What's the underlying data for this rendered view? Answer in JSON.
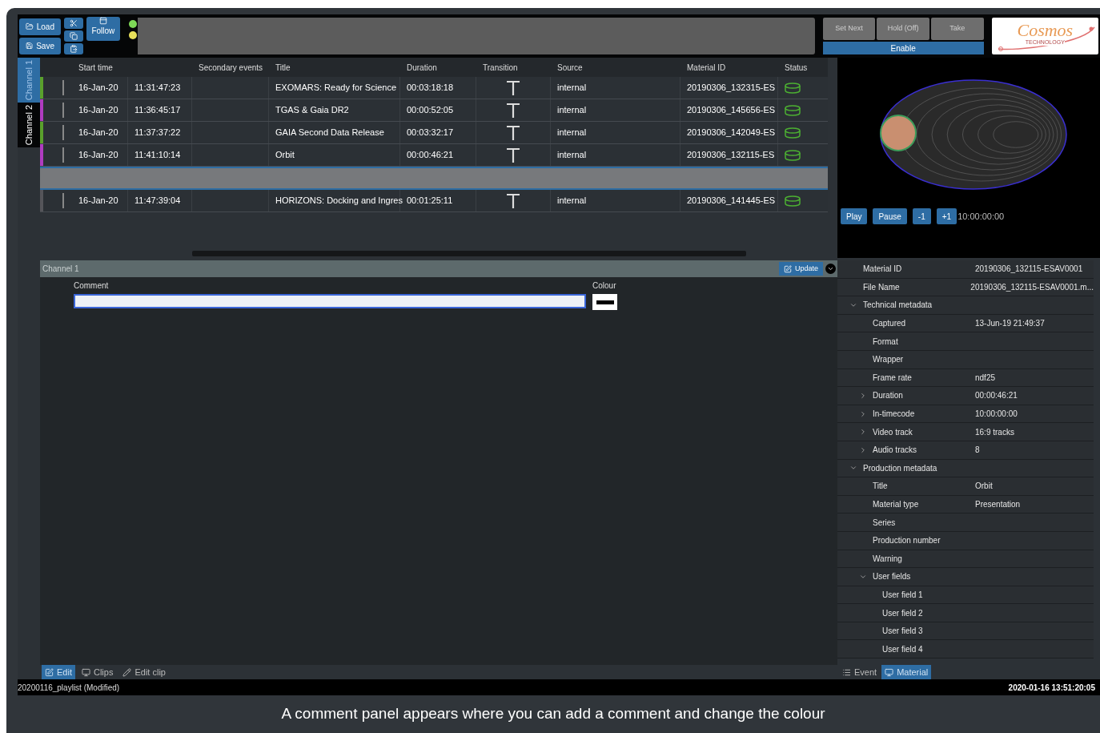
{
  "toolbar": {
    "load": "Load",
    "save": "Save",
    "follow": "Follow",
    "indicators": [
      {
        "color": "#7ed957"
      },
      {
        "color": "#e8e05a"
      }
    ],
    "take_buttons": [
      {
        "label": "Set Next",
        "disabled": true
      },
      {
        "label": "Hold (Off)",
        "disabled": true
      },
      {
        "label": "Take",
        "disabled": true
      }
    ],
    "enable": "Enable",
    "logo": {
      "name": "Cosmos",
      "tagline": "TECHNOLOGY"
    }
  },
  "channel_tabs": [
    {
      "label": "Channel 1",
      "selected": true
    },
    {
      "label": "Channel 2",
      "selected": false
    }
  ],
  "table": {
    "columns": [
      "Start time",
      "Secondary events",
      "Title",
      "Duration",
      "Transition",
      "Source",
      "Material ID",
      "Status"
    ],
    "rows": [
      {
        "kind": "event",
        "color": "#5aa02c",
        "selected": false,
        "date": "16-Jan-20",
        "time": "11:31:47:23",
        "title": "EXOMARS: Ready for Science",
        "duration": "00:03:18:18",
        "source": "internal",
        "material_id": "20190306_132315-ES"
      },
      {
        "kind": "event",
        "color": "#b03cc0",
        "selected": false,
        "date": "16-Jan-20",
        "time": "11:36:45:17",
        "title": "TGAS & Gaia DR2",
        "duration": "00:00:52:05",
        "source": "internal",
        "material_id": "20190306_145656-ES"
      },
      {
        "kind": "event",
        "color": "#5aa02c",
        "selected": false,
        "date": "16-Jan-20",
        "time": "11:37:37:22",
        "title": "GAIA Second Data Release",
        "duration": "00:03:32:17",
        "source": "internal",
        "material_id": "20190306_142049-ES"
      },
      {
        "kind": "event",
        "color": "#b03cc0",
        "selected": false,
        "date": "16-Jan-20",
        "time": "11:41:10:14",
        "title": "Orbit",
        "duration": "00:00:46:21",
        "source": "internal",
        "material_id": "20190306_132115-ES"
      },
      {
        "kind": "gap",
        "selected": true
      },
      {
        "kind": "event",
        "color": "#55555a",
        "selected": false,
        "date": "16-Jan-20",
        "time": "11:47:39:04",
        "title": "HORIZONS: Docking and Ingres",
        "duration": "00:01:25:11",
        "source": "internal",
        "material_id": "20190306_141445-ES"
      }
    ]
  },
  "preview": {
    "buttons": [
      "Play",
      "Pause",
      "-1",
      "+1"
    ],
    "timecode": "10:00:00:00"
  },
  "comment_panel": {
    "title": "Channel 1",
    "update": "Update",
    "comment_label": "Comment",
    "colour_label": "Colour"
  },
  "metadata": [
    {
      "label": "Material ID",
      "value": "20190306_132115-ESAV0001"
    },
    {
      "label": "File Name",
      "value": "20190306_132115-ESAV0001.m..."
    },
    {
      "label": "Technical metadata",
      "expanded": true,
      "children": [
        {
          "label": "Captured",
          "value": "13-Jun-19 21:49:37"
        },
        {
          "label": "Format"
        },
        {
          "label": "Wrapper"
        },
        {
          "label": "Frame rate",
          "value": "ndf25"
        },
        {
          "label": "Duration",
          "value": "00:00:46:21",
          "expanded": false
        },
        {
          "label": "In-timecode",
          "value": "10:00:00:00",
          "expanded": false
        },
        {
          "label": "Video track",
          "value": "16:9 tracks",
          "expanded": false
        },
        {
          "label": "Audio tracks",
          "value": "8",
          "expanded": false
        }
      ]
    },
    {
      "label": "Production metadata",
      "expanded": true,
      "children": [
        {
          "label": "Title",
          "value": "Orbit"
        },
        {
          "label": "Material type",
          "value": "Presentation"
        },
        {
          "label": "Series"
        },
        {
          "label": "Production number"
        },
        {
          "label": "Warning"
        },
        {
          "label": "User fields",
          "expanded": true,
          "children": [
            {
              "label": "User field 1"
            },
            {
              "label": "User field 2"
            },
            {
              "label": "User field 3"
            },
            {
              "label": "User field 4"
            }
          ]
        }
      ]
    }
  ],
  "left_tabs": [
    {
      "label": "Edit",
      "selected": true
    },
    {
      "label": "Clips",
      "selected": false
    },
    {
      "label": "Edit clip",
      "selected": false
    }
  ],
  "right_tabs": [
    {
      "label": "Event",
      "selected": false
    },
    {
      "label": "Material",
      "selected": true
    }
  ],
  "status_bar": {
    "file": "20200116_playlist (Modified)",
    "datetime": "2020-01-16 13:51:20:05"
  },
  "caption": "A comment panel appears where you can add a comment and change the colour"
}
